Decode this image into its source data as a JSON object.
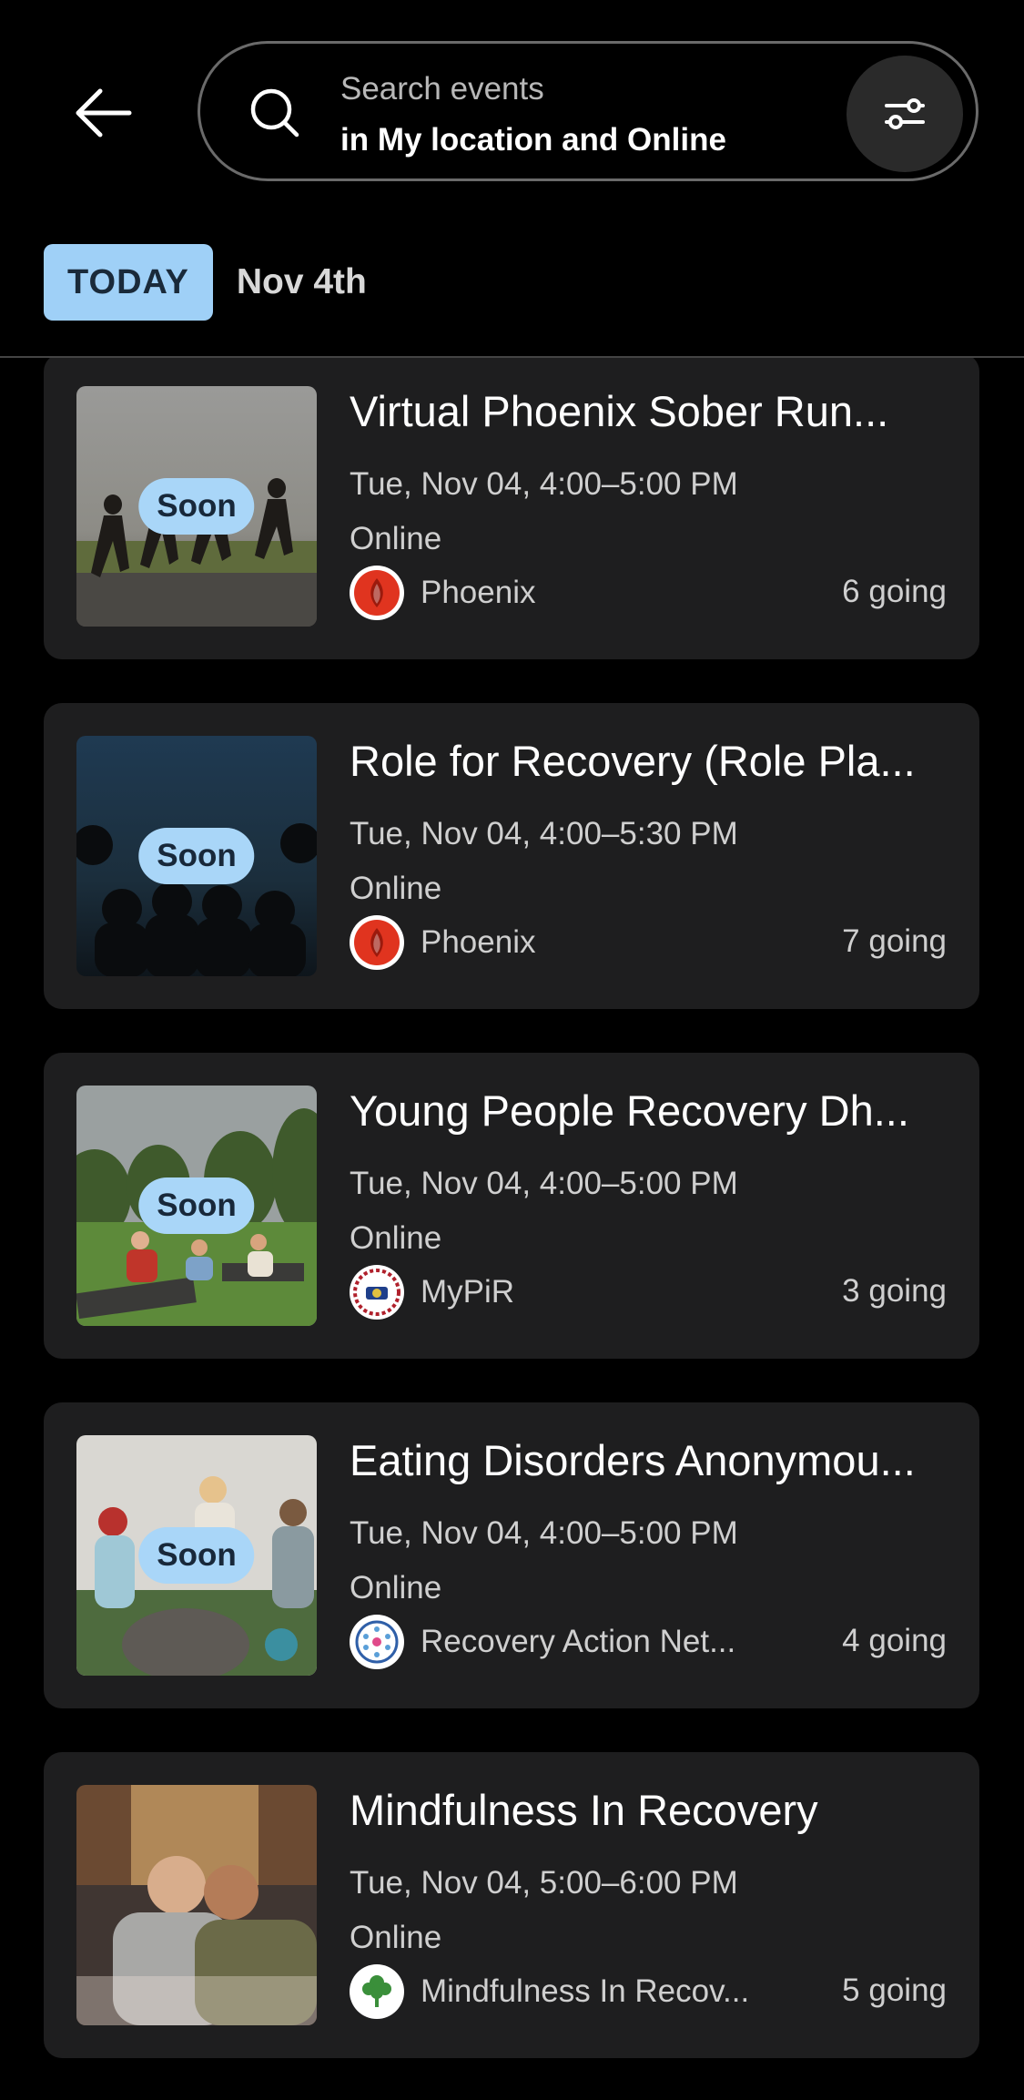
{
  "search": {
    "placeholder": "Search events",
    "location": "in My location and Online"
  },
  "date_header": {
    "today_label": "TODAY",
    "date": "Nov 4th"
  },
  "colors": {
    "background": "#000000",
    "card": "#1e1e1f",
    "badge": "#a9d6f8"
  },
  "events": [
    {
      "title": "Virtual Phoenix Sober Run...",
      "when": "Tue, Nov 04, 4:00–5:00 PM",
      "where": "Online",
      "org": "Phoenix",
      "going": "6 going",
      "badge": "Soon"
    },
    {
      "title": "Role for Recovery (Role Pla...",
      "when": "Tue, Nov 04, 4:00–5:30 PM",
      "where": "Online",
      "org": "Phoenix",
      "going": "7 going",
      "badge": "Soon"
    },
    {
      "title": "Young People Recovery Dh...",
      "when": "Tue, Nov 04, 4:00–5:00 PM",
      "where": "Online",
      "org": "MyPiR",
      "going": "3 going",
      "badge": "Soon"
    },
    {
      "title": "Eating Disorders Anonymou...",
      "when": "Tue, Nov 04, 4:00–5:00 PM",
      "where": "Online",
      "org": "Recovery Action Net...",
      "going": "4 going",
      "badge": "Soon"
    },
    {
      "title": "Mindfulness In Recovery",
      "when": "Tue, Nov 04, 5:00–6:00 PM",
      "where": "Online",
      "org": "Mindfulness In Recov...",
      "going": "5 going"
    }
  ]
}
